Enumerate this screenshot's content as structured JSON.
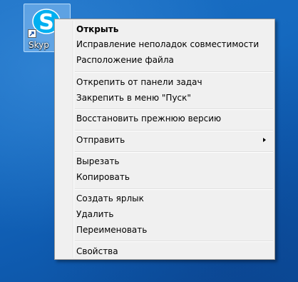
{
  "desktop": {
    "icon": {
      "label": "Skyp",
      "logo_letter": "S",
      "icon_name": "skype-icon",
      "brand_color": "#00aff0",
      "selected": true
    },
    "background_color": "#1569bf"
  },
  "context_menu": {
    "items": [
      {
        "label": "Открыть",
        "bold": true
      },
      {
        "label": "Исправление неполадок совместимости"
      },
      {
        "label": "Расположение файла"
      },
      {
        "label": "Открепить от панели задач"
      },
      {
        "label": "Закрепить в меню \"Пуск\""
      },
      {
        "label": "Восстановить прежнюю версию"
      },
      {
        "label": "Отправить",
        "has_submenu": true
      },
      {
        "label": "Вырезать"
      },
      {
        "label": "Копировать"
      },
      {
        "label": "Создать ярлык"
      },
      {
        "label": "Удалить"
      },
      {
        "label": "Переименовать"
      },
      {
        "label": "Свойства"
      }
    ]
  }
}
